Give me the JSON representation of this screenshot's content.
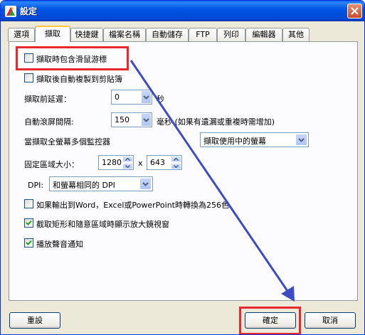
{
  "window": {
    "title": "設定"
  },
  "tabs": [
    {
      "label": "選項",
      "active": false
    },
    {
      "label": "擷取",
      "active": true
    },
    {
      "label": "快捷鍵",
      "active": false
    },
    {
      "label": "檔案名稱",
      "active": false
    },
    {
      "label": "自動儲存",
      "active": false
    },
    {
      "label": "FTP",
      "active": false
    },
    {
      "label": "列印",
      "active": false
    },
    {
      "label": "編輯器",
      "active": false
    },
    {
      "label": "其他",
      "active": false
    }
  ],
  "capture": {
    "include_cursor": {
      "label": "擷取時包含滑鼠游標",
      "checked": false
    },
    "copy_to_clipboard": {
      "label": "擷取後自動複製到剪貼簿",
      "checked": false
    },
    "delay": {
      "label": "擷取前延遲：",
      "value": "0",
      "unit": "秒"
    },
    "scroll_interval": {
      "label": "自動滾屏間隔:",
      "value": "150",
      "unit": "毫秒 (如果有遺漏或重複時需增加)"
    },
    "multi_monitor": {
      "label": "當擷取全螢幕多個監控器",
      "selected": "擷取使用中的螢幕"
    },
    "fixed_area": {
      "label": "固定區域大小：",
      "width": "1280",
      "separator": "x",
      "height": "643"
    },
    "dpi": {
      "label": "DPI:",
      "selected": "和螢幕相同的 DPI"
    },
    "convert_256": {
      "label": "如果輸出到Word，Excel或PowerPoint時轉換為256色",
      "checked": false
    },
    "magnifier": {
      "label": "截取矩形和隨意區域時顯示放大鏡視窗",
      "checked": true
    },
    "play_sound": {
      "label": "播放聲音通知",
      "checked": true
    }
  },
  "footer": {
    "reset_label": "重設",
    "ok_label": "確定",
    "cancel_label": "取消"
  },
  "annotation": {
    "color": "#E8282E",
    "arrow_color": "#3D4CC4"
  }
}
